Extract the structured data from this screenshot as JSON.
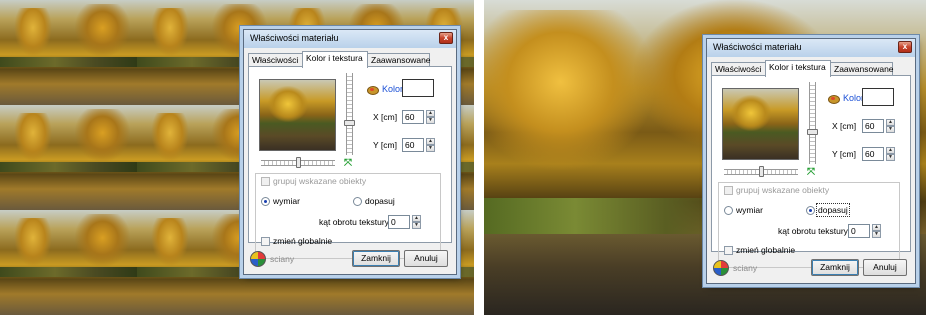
{
  "dialog": {
    "title": "Właściwości materiału",
    "close_glyph": "x",
    "tabs": [
      {
        "label": "Właściwości"
      },
      {
        "label": "Kolor i tekstura"
      },
      {
        "label": "Zaawansowane"
      }
    ],
    "active_tab": "Kolor i tekstura",
    "kolor_label": "Kolor",
    "kolor_swatch_color": "#ffffff",
    "x_label": "X [cm]",
    "x_value": "60",
    "y_label": "Y [cm]",
    "y_value": "60",
    "group_checkbox_label": "grupuj wskazane obiekty",
    "radio_wymiar": "wymiar",
    "radio_dopasuj": "dopasuj",
    "rotation_label": "kąt obrotu tekstury",
    "rotation_value": "0",
    "global_checkbox_label": "zmień globalnie",
    "footer_label": "sciany",
    "close_button": "Zamknij",
    "cancel_button": "Anuluj"
  },
  "left_state": {
    "selected_radio": "wymiar"
  },
  "right_state": {
    "selected_radio": "dopasuj"
  },
  "icons": {
    "close": "close-icon",
    "paint": "paint-palette-icon",
    "fit": "fit-arrows-icon",
    "globe": "globe-icon"
  }
}
